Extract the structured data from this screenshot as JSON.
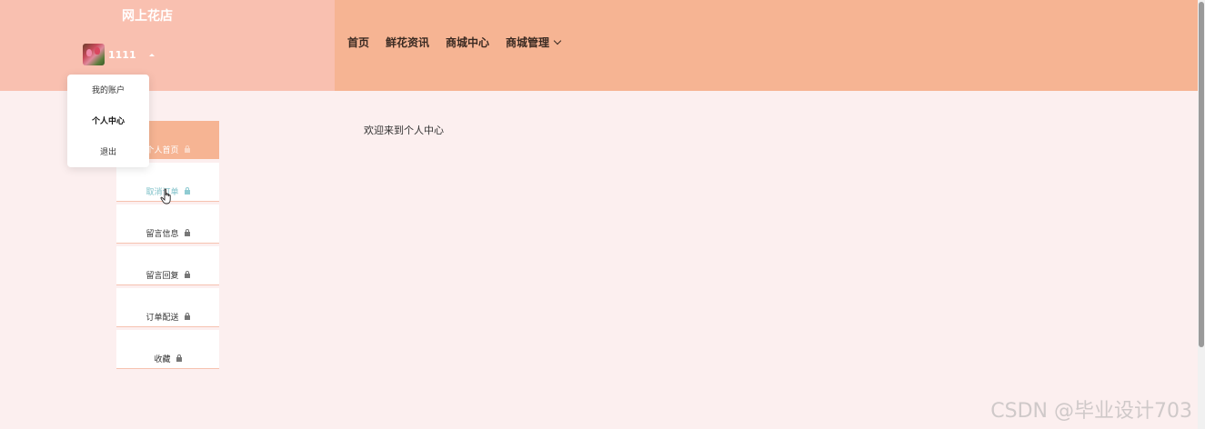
{
  "site": {
    "title": "网上花店"
  },
  "user": {
    "name": "1111"
  },
  "user_menu": {
    "items": [
      {
        "label": "我的账户"
      },
      {
        "label": "个人中心"
      },
      {
        "label": "退出"
      }
    ]
  },
  "nav": {
    "items": [
      {
        "label": "首页"
      },
      {
        "label": "鲜花资讯"
      },
      {
        "label": "商城中心"
      },
      {
        "label": "商城管理"
      }
    ]
  },
  "side_menu": {
    "items": [
      {
        "label": "个人首页"
      },
      {
        "label": "取消订单"
      },
      {
        "label": "留言信息"
      },
      {
        "label": "留言回复"
      },
      {
        "label": "订单配送"
      },
      {
        "label": "收藏"
      }
    ]
  },
  "main": {
    "welcome": "欢迎来到个人中心"
  },
  "watermark": {
    "text": "CSDN @毕业设计703"
  },
  "colors": {
    "header_left": "#f9c0b0",
    "header_right": "#f6b493",
    "page_bg": "#fcefef",
    "menu_active": "#f6b493",
    "menu_hover_text": "#7ec0c8"
  }
}
